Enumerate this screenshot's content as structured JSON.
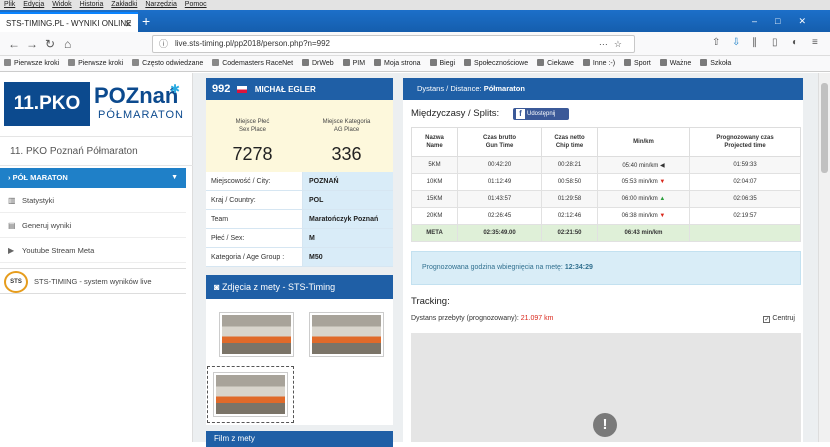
{
  "browser": {
    "menu": [
      "Plik",
      "Edycja",
      "Widok",
      "Historia",
      "Zakładki",
      "Narzędzia",
      "Pomoc"
    ],
    "tab_title": "STS-TIMING.PL - WYNIKI ONLINE",
    "url": "live.sts-timing.pl/pp2018/person.php?n=992",
    "bookmarks": [
      "Pierwsze kroki",
      "Pierwsze kroki",
      "Często odwiedzane",
      "Codemasters RaceNet",
      "DrWeb",
      "PIM",
      "Moja strona",
      "Biegi",
      "Społecznościowe",
      "Ciekawe",
      "Inne :-)",
      "Sport",
      "Ważne",
      "Szkoła"
    ]
  },
  "sidebar": {
    "logo_left": "11.PKO",
    "logo_right": "POZnań",
    "logo_sub": "PÓŁMARATON",
    "event_title": "11. PKO Poznań Półmaraton",
    "active_item": "PÓŁ MARATON",
    "items": [
      "Statystyki",
      "Generuj wyniki",
      "Youtube Stream Meta"
    ],
    "sts_logo": "STS",
    "sts_text": "STS-TIMING - system wyników live"
  },
  "runner": {
    "bib": "992",
    "name": "MICHAŁ EGLER",
    "sex_place_label_1": "Miejsce Płeć",
    "sex_place_label_2": "Sex Place",
    "sex_place": "7278",
    "cat_place_label_1": "Miejsce Kategoria",
    "cat_place_label_2": "AG Place",
    "cat_place": "336",
    "info": [
      {
        "k": "Miejscowość / City:",
        "v": "POZNAŃ"
      },
      {
        "k": "Kraj / Country:",
        "v": "POL"
      },
      {
        "k": "Team",
        "v": "Maratończyk Poznań"
      },
      {
        "k": "Płeć / Sex:",
        "v": "M"
      },
      {
        "k": "Kategoria / Age Group :",
        "v": "M50"
      }
    ]
  },
  "photos": {
    "title": "Zdjęcia z mety - STS-Timing",
    "film_title": "Film z mety"
  },
  "distance": {
    "label": "Dystans / Distance:",
    "value": "Półmaraton"
  },
  "splits": {
    "title": "Międzyczasy / Splits:",
    "share": "Udostępnij",
    "headers": [
      [
        "Nazwa",
        "Name"
      ],
      [
        "Czas brutto",
        "Gun Time"
      ],
      [
        "Czas netto",
        "Chip time"
      ],
      [
        "Min/km",
        ""
      ],
      [
        "Prognozowany czas",
        "Projected time"
      ]
    ],
    "rows": [
      {
        "name": "5KM",
        "gun": "00:42:20",
        "chip": "00:28:21",
        "pace": "05:40 min/km",
        "trend": "eq",
        "proj": "01:59:33"
      },
      {
        "name": "10KM",
        "gun": "01:12:49",
        "chip": "00:58:50",
        "pace": "05:53 min/km",
        "trend": "dn",
        "proj": "02:04:07"
      },
      {
        "name": "15KM",
        "gun": "01:43:57",
        "chip": "01:29:58",
        "pace": "06:00 min/km",
        "trend": "up",
        "proj": "02:06:35"
      },
      {
        "name": "20KM",
        "gun": "02:26:45",
        "chip": "02:12:46",
        "pace": "06:38 min/km",
        "trend": "dn",
        "proj": "02:19:57"
      }
    ],
    "meta": {
      "name": "META",
      "gun": "02:35:49.00",
      "chip": "02:21:50",
      "pace": "06:43 min/km",
      "proj": ""
    }
  },
  "prediction": {
    "label": "Prognozowana godzina wbiegnięcia na metę:",
    "value": "12:34:29"
  },
  "tracking": {
    "title": "Tracking:",
    "dist_label": "Dystans przebyty (prognozowany):",
    "dist_value": "21.097 km",
    "center_label": "Centruj"
  }
}
